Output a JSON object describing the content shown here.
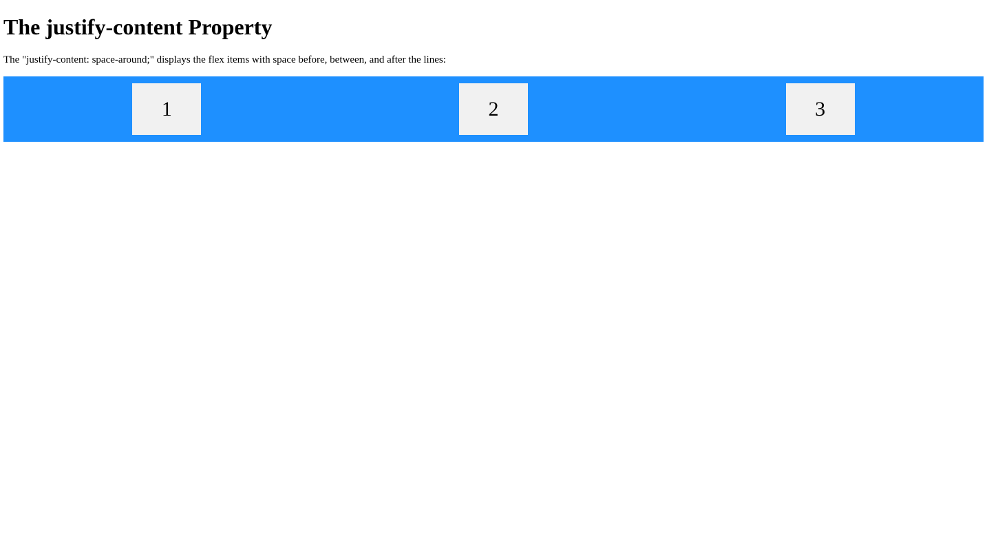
{
  "page": {
    "heading": "The justify-content Property",
    "description": "The \"justify-content: space-around;\" displays the flex items with space before, between, and after the lines:"
  },
  "flex_container": {
    "background_color": "#1e90ff",
    "item_color": "#f1f1f1",
    "items": [
      {
        "label": "1"
      },
      {
        "label": "2"
      },
      {
        "label": "3"
      }
    ]
  }
}
